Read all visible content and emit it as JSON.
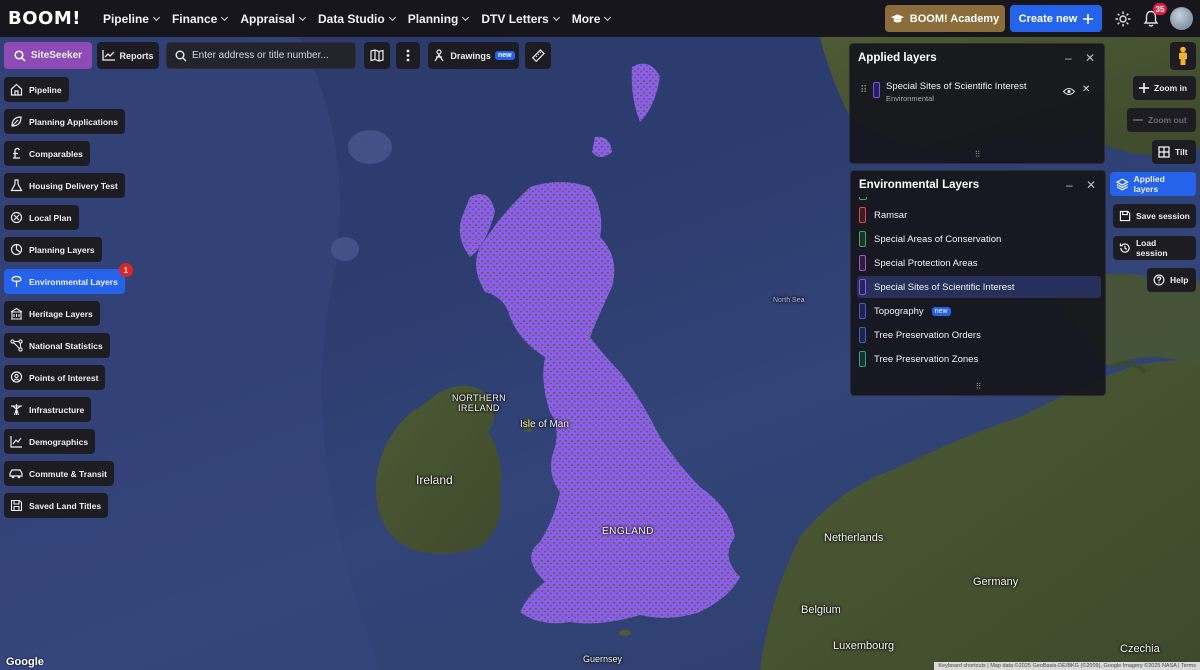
{
  "topbar": {
    "logo": "BOOM!",
    "nav": [
      {
        "label": "Pipeline",
        "has_menu": true
      },
      {
        "label": "Finance",
        "has_menu": true
      },
      {
        "label": "Appraisal",
        "has_menu": true
      },
      {
        "label": "Data Studio",
        "has_menu": true
      },
      {
        "label": "Planning",
        "has_menu": true
      },
      {
        "label": "DTV Letters",
        "has_menu": true
      },
      {
        "label": "More",
        "has_menu": true
      }
    ],
    "academy_label": "BOOM! Academy",
    "create_label": "Create new",
    "notifications_count": "35",
    "colors": {
      "academy": "#8a6d3b",
      "create": "#2563eb",
      "badge": "#e11d48"
    }
  },
  "toolbar": {
    "siteseeker_label": "SiteSeeker",
    "reports_label": "Reports",
    "search_placeholder": "Enter address or title number...",
    "drawings_label": "Drawings",
    "drawings_tag": "new"
  },
  "sidebar": {
    "items": [
      {
        "label": "Pipeline",
        "icon": "house-icon"
      },
      {
        "label": "Planning Applications",
        "icon": "leaf-icon"
      },
      {
        "label": "Comparables",
        "icon": "pound-icon"
      },
      {
        "label": "Housing Delivery Test",
        "icon": "flask-icon"
      },
      {
        "label": "Local Plan",
        "icon": "map-pin-icon"
      },
      {
        "label": "Planning Layers",
        "icon": "compass-icon"
      },
      {
        "label": "Environmental Layers",
        "icon": "tree-icon",
        "active": true,
        "badge": "1"
      },
      {
        "label": "Heritage Layers",
        "icon": "building-icon"
      },
      {
        "label": "National Statistics",
        "icon": "nodes-icon"
      },
      {
        "label": "Points of Interest",
        "icon": "person-pin-icon"
      },
      {
        "label": "Infrastructure",
        "icon": "pylon-icon"
      },
      {
        "label": "Demographics",
        "icon": "chart-icon"
      },
      {
        "label": "Commute & Transit",
        "icon": "car-icon"
      },
      {
        "label": "Saved Land Titles",
        "icon": "save-icon"
      }
    ]
  },
  "right_controls": {
    "zoom_in": "Zoom in",
    "zoom_out": "Zoom out",
    "tilt": "Tilt",
    "applied_layers": "Applied layers",
    "save_session": "Save session",
    "load_session": "Load session",
    "help": "Help"
  },
  "applied_panel": {
    "title": "Applied layers",
    "layers": [
      {
        "name": "Special Sites of Scientific Interest",
        "category": "Environmental",
        "color": "#7c4dff"
      }
    ]
  },
  "env_panel": {
    "title": "Environmental Layers",
    "layers": [
      {
        "name": "Ramsar",
        "color": "#e04848"
      },
      {
        "name": "Special Areas of Conservation",
        "color": "#3ba56a"
      },
      {
        "name": "Special Protection Areas",
        "color": "#9b59d0"
      },
      {
        "name": "Special Sites of Scientific Interest",
        "color": "#7c5cff",
        "selected": true
      },
      {
        "name": "Topography",
        "color": "#4b56d6",
        "tag": "new"
      },
      {
        "name": "Tree Preservation Orders",
        "color": "#3a62c9"
      },
      {
        "name": "Tree Preservation Zones",
        "color": "#2aa58a"
      }
    ]
  },
  "map_labels": {
    "northern_ireland_1": "NORTHERN",
    "northern_ireland_2": "IRELAND",
    "isle_of_man": "Isle of Man",
    "ireland": "Ireland",
    "england": "ENGLAND",
    "netherlands": "Netherlands",
    "germany": "Germany",
    "belgium": "Belgium",
    "luxembourg": "Luxembourg",
    "czechia": "Czechia",
    "guernsey": "Guernsey",
    "north_sea": "North Sea",
    "google": "Google",
    "attribution": "Keyboard shortcuts  |  Map data ©2025 GeoBasis-DE/BKG (©2009), Google Imagery ©2025 NASA  |  Terms"
  }
}
